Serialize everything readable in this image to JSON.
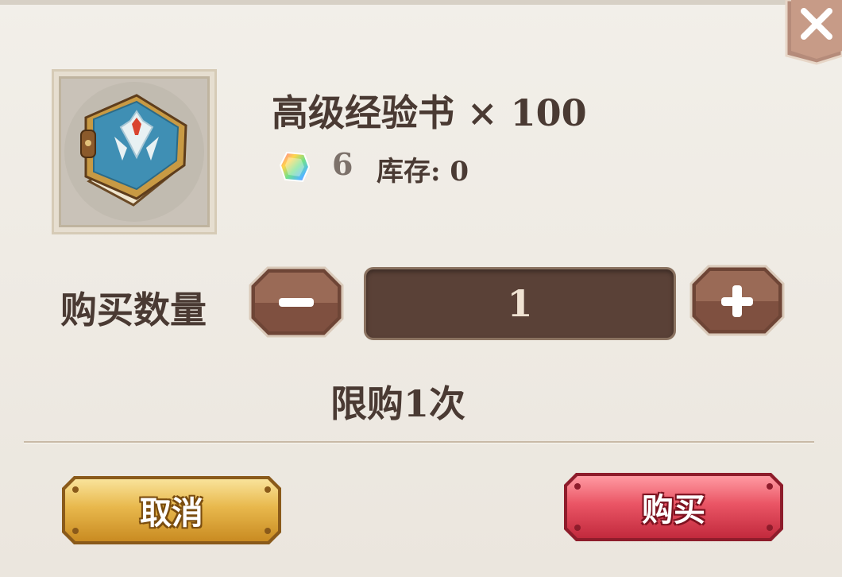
{
  "item": {
    "name_label": "高级经验书 × 100",
    "icon": "blue-experience-book-icon",
    "price": "6",
    "currency_icon": "rainbow-gem-icon",
    "stock_label": "库存: 0"
  },
  "purchase": {
    "quantity_label": "购买数量",
    "quantity_value": "1",
    "limit_label": "限购1次"
  },
  "buttons": {
    "cancel_label": "取消",
    "buy_label": "购买"
  },
  "colors": {
    "panel_bg": "#efebe4",
    "text_dark": "#4a3a33",
    "stepper_brown": "#8a5a49",
    "cancel_gold": "#e3b347",
    "buy_red": "#e1475a"
  }
}
